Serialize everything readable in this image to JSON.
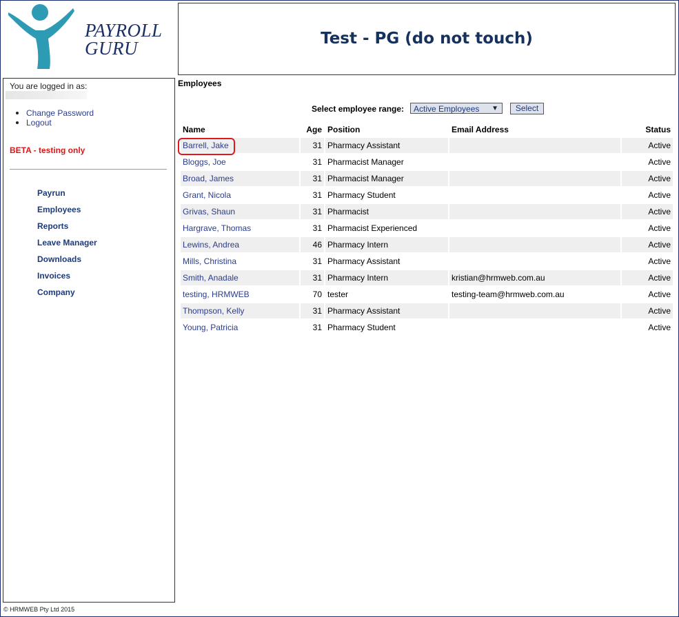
{
  "logo": {
    "line1": "PAYROLL",
    "line2": "GURU",
    "color": "#2e9bb5"
  },
  "header": {
    "title": "Test - PG (do not touch)"
  },
  "sidebar": {
    "logged_in_label": "You are logged in as:",
    "account_links": [
      {
        "label": "Change Password"
      },
      {
        "label": "Logout"
      }
    ],
    "beta_notice": "BETA - testing only",
    "nav": [
      {
        "label": "Payrun"
      },
      {
        "label": "Employees"
      },
      {
        "label": "Reports"
      },
      {
        "label": "Leave Manager"
      },
      {
        "label": "Downloads"
      },
      {
        "label": "Invoices"
      },
      {
        "label": "Company"
      }
    ]
  },
  "main": {
    "section_title": "Employees",
    "range_label": "Select employee range:",
    "range_value": "Active Employees",
    "select_button": "Select",
    "columns": [
      "Name",
      "Age",
      "Position",
      "Email Address",
      "Status"
    ],
    "rows": [
      {
        "name": "Barrell, Jake",
        "age": "31",
        "position": "Pharmacy Assistant",
        "email": "",
        "status": "Active"
      },
      {
        "name": "Bloggs, Joe",
        "age": "31",
        "position": "Pharmacist Manager",
        "email": "",
        "status": "Active"
      },
      {
        "name": "Broad, James",
        "age": "31",
        "position": "Pharmacist Manager",
        "email": "",
        "status": "Active"
      },
      {
        "name": "Grant, Nicola",
        "age": "31",
        "position": "Pharmacy Student",
        "email": "",
        "status": "Active"
      },
      {
        "name": "Grivas, Shaun",
        "age": "31",
        "position": "Pharmacist",
        "email": "",
        "status": "Active"
      },
      {
        "name": "Hargrave, Thomas",
        "age": "31",
        "position": "Pharmacist Experienced",
        "email": "",
        "status": "Active"
      },
      {
        "name": "Lewins, Andrea",
        "age": "46",
        "position": "Pharmacy Intern",
        "email": "",
        "status": "Active"
      },
      {
        "name": "Mills, Christina",
        "age": "31",
        "position": "Pharmacy Assistant",
        "email": "",
        "status": "Active"
      },
      {
        "name": "Smith, Anadale",
        "age": "31",
        "position": "Pharmacy Intern",
        "email": "kristian@hrmweb.com.au",
        "status": "Active"
      },
      {
        "name": "testing, HRMWEB",
        "age": "70",
        "position": "tester",
        "email": "testing-team@hrmweb.com.au",
        "status": "Active"
      },
      {
        "name": "Thompson, Kelly",
        "age": "31",
        "position": "Pharmacy Assistant",
        "email": "",
        "status": "Active"
      },
      {
        "name": "Young, Patricia",
        "age": "31",
        "position": "Pharmacy Student",
        "email": "",
        "status": "Active"
      }
    ],
    "highlighted_row": 0
  },
  "footer": {
    "copyright": "© HRMWEB Pty Ltd 2015"
  }
}
